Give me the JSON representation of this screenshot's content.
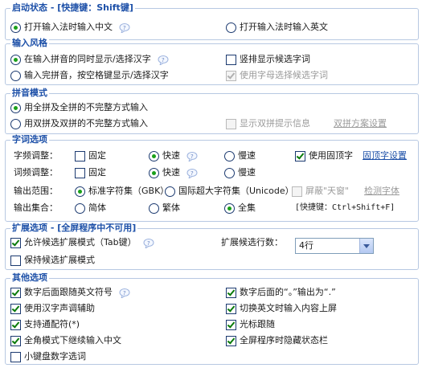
{
  "startup": {
    "title": "启动状态 - [快捷键：Shift键]",
    "options": [
      "打开输入法时输入中文",
      "打开输入法时输入英文"
    ]
  },
  "style": {
    "title": "输入风格",
    "opt1": "在输入拼音的同时显示/选择汉字",
    "opt2": "输入完拼音，按空格键显示/选择汉字",
    "vertical": "竖排显示候选字词",
    "letter_select": "使用字母选择候选字词"
  },
  "pinyin": {
    "title": "拼音模式",
    "opt1": "用全拼及全拼的不完整方式输入",
    "opt2": "用双拼及双拼的不完整方式输入",
    "show_tips": "显示双拼提示信息",
    "scheme_link": "双拼方案设置"
  },
  "words": {
    "title": "字词选项",
    "char_freq_label": "字频调整：",
    "word_freq_label": "词频调整：",
    "fixed": "固定",
    "fast": "快速",
    "slow": "慢速",
    "use_fixed": "使用固顶字",
    "fixed_link": "固顶字设置",
    "range_label": "输出范围：",
    "range_std": "标准字符集（GBK）",
    "range_intl": "国际超大字符集（Unicode）",
    "block_tiangai": "屏蔽\"天窗\"",
    "detect_font": "检测字体",
    "set_label": "输出集合：",
    "simplified": "简体",
    "traditional": "繁体",
    "full": "全集",
    "shortcut": "[快捷键：Ctrl+Shift+F]"
  },
  "expand": {
    "title": "扩展选项 - [全屏程序中不可用]",
    "allow": "允许候选扩展模式（Tab键）",
    "keep": "保持候选扩展模式",
    "rows_label": "扩展候选行数：",
    "rows_value": "4行"
  },
  "other": {
    "title": "其他选项",
    "left": [
      "数字后面跟随英文符号",
      "使用汉字声调辅助",
      "支持通配符(*)",
      "全角模式下继续输入中文",
      "小键盘数字选词"
    ],
    "right": [
      "数字后面的“。”输出为“.”",
      "切换英文时输入内容上屏",
      "光标跟随",
      "全屏程序时隐藏状态栏"
    ]
  },
  "colors": {
    "accent": "#1d50a8",
    "check": "#0a7a0a",
    "radio": "#1aa01a",
    "border": "#b7c8e2"
  },
  "icons": {
    "help": "help-bubble-icon"
  }
}
